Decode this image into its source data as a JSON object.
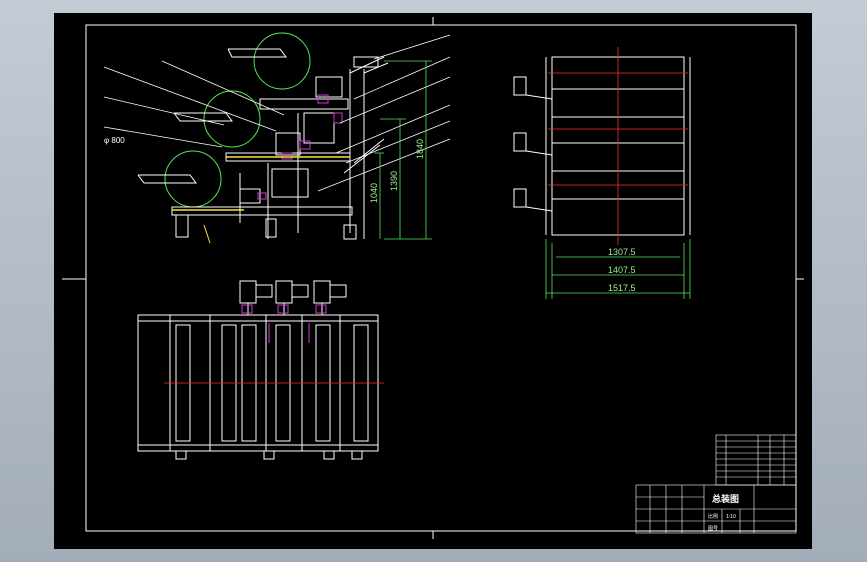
{
  "drawing": {
    "colors": {
      "background": "#000000",
      "outline": "#ffffff",
      "dimension": "#57e65c",
      "centerline": "#ff2a2a",
      "motor": "#d43dd4",
      "highlight": "#ffe23a"
    },
    "side_view": {
      "diameter_label": "φ 800",
      "height_dims": [
        "1040",
        "1390",
        "1840"
      ]
    },
    "end_view": {
      "width_dims": [
        "1307.5",
        "1407.5",
        "1517.5"
      ]
    },
    "title_block": {
      "drawing_name": "总装图",
      "cells": [
        "比例",
        "1:10",
        "图号"
      ]
    }
  }
}
